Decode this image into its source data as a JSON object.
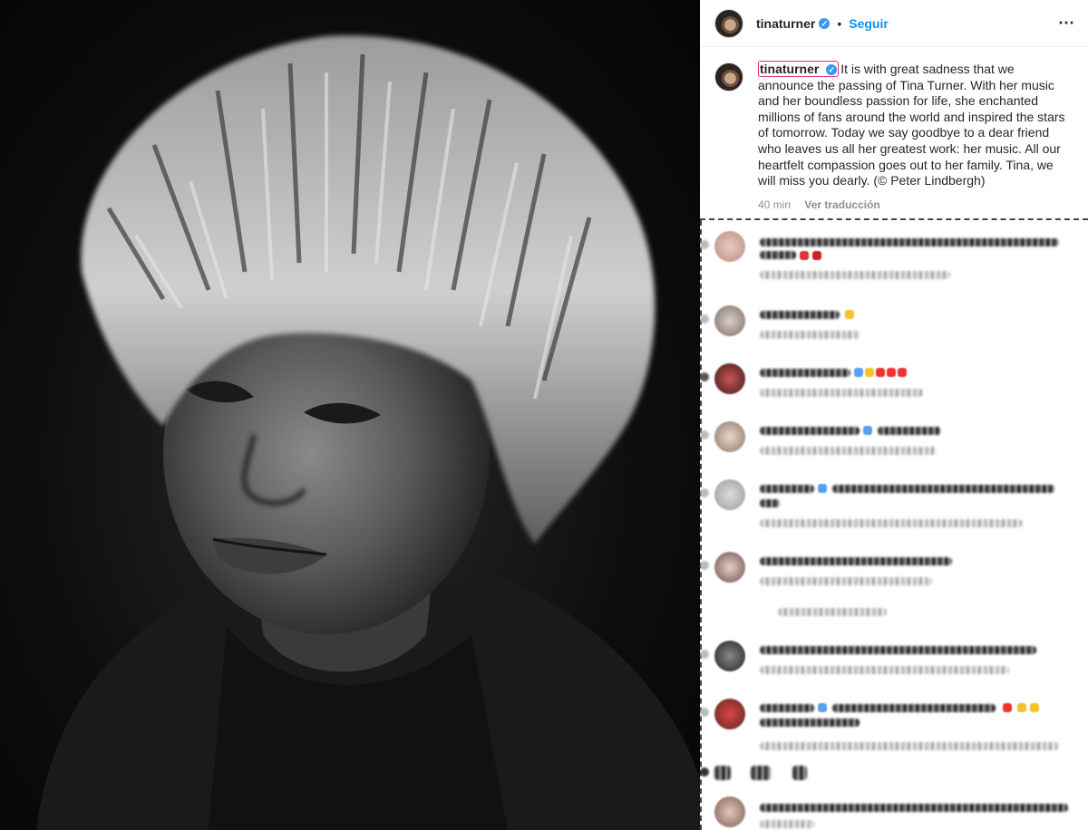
{
  "header": {
    "username": "tinaturner",
    "verified_mark": "✓",
    "separator": "•",
    "follow_label": "Seguir",
    "more_icon": "⋯"
  },
  "caption": {
    "username": "tinaturner",
    "verified_mark": "✓",
    "text": "It is with great sadness that we announce the passing of Tina Turner. With her music and her boundless passion for life, she enchanted millions of fans around the world and inspired the stars of tomorrow. Today we say goodbye to a dear friend who leaves us all her greatest work: her music. All our heartfelt compassion goes out to her family. Tina, we will miss you dearly. (© Peter Lindbergh)",
    "time": "40 min",
    "translate_label": "Ver traducción"
  },
  "colors": {
    "accent": "#0095f6",
    "verified": "#3897f0",
    "highlight_border": "#e1306c",
    "text": "#262626",
    "muted": "#8e8e8e"
  }
}
